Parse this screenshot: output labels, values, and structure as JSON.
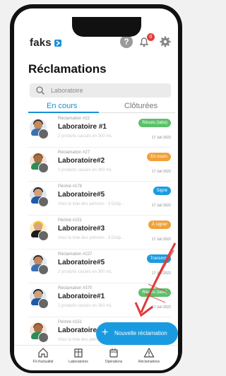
{
  "header": {
    "brand": "faks",
    "help": "?",
    "notification_count": "0"
  },
  "page": {
    "title": "Réclamations"
  },
  "search": {
    "placeholder": "Laboratoire"
  },
  "tabs": [
    {
      "label": "En cours"
    },
    {
      "label": "Clôturées"
    }
  ],
  "items": [
    {
      "kicker": "Réclamation #22",
      "name": "Laboratoire #1",
      "sub": "2 produits cassés en 300 mL",
      "date": "17 Juil 2022",
      "status": "Résolu (labo)",
      "status_color": "#5cc06a"
    },
    {
      "kicker": "Réclamation #27",
      "name": "Laboratoire#2",
      "sub": "2 produits cassés en 300 mL",
      "date": "17 Juil 2022",
      "status": "En cours",
      "status_color": "#f0a23a"
    },
    {
      "kicker": "Périmé #178",
      "name": "Laboratoire#5",
      "sub": "Voici la liste des périmés : 3 Dolip...",
      "date": "17 Juil 2022",
      "status": "Signé",
      "status_color": "#1a9be0"
    },
    {
      "kicker": "Périmé #151",
      "name": "Laboratoire#3",
      "sub": "Voici la liste des périmés : 3 Dolip...",
      "date": "17 Juil 2022",
      "status": "À signer",
      "status_color": "#f0a23a"
    },
    {
      "kicker": "Réclamation #227",
      "name": "Laboratoire#5",
      "sub": "2 produits cassés en 300 mL",
      "date": "17 Juil 2022",
      "status": "Transmis",
      "status_color": "#1a9be0"
    },
    {
      "kicker": "Réclamation #370",
      "name": "Laboratoire#1",
      "sub": "2 produits cassés en 300 mL",
      "date": "17 Juil 2022",
      "status": "Résolu (labo)",
      "status_color": "#5cc06a"
    },
    {
      "kicker": "Périmé #151",
      "name": "Laboratoire",
      "sub": "Voici la liste des périmés : 3 Dolip...",
      "date": "",
      "status": "",
      "status_color": "#999999"
    }
  ],
  "fab": {
    "plus": "+",
    "label": "Nouvelle réclamation"
  },
  "tabbar": [
    {
      "label": "Fil d'actualité"
    },
    {
      "label": "Laboratoires"
    },
    {
      "label": "Opérations"
    },
    {
      "label": "Réclamations"
    }
  ]
}
